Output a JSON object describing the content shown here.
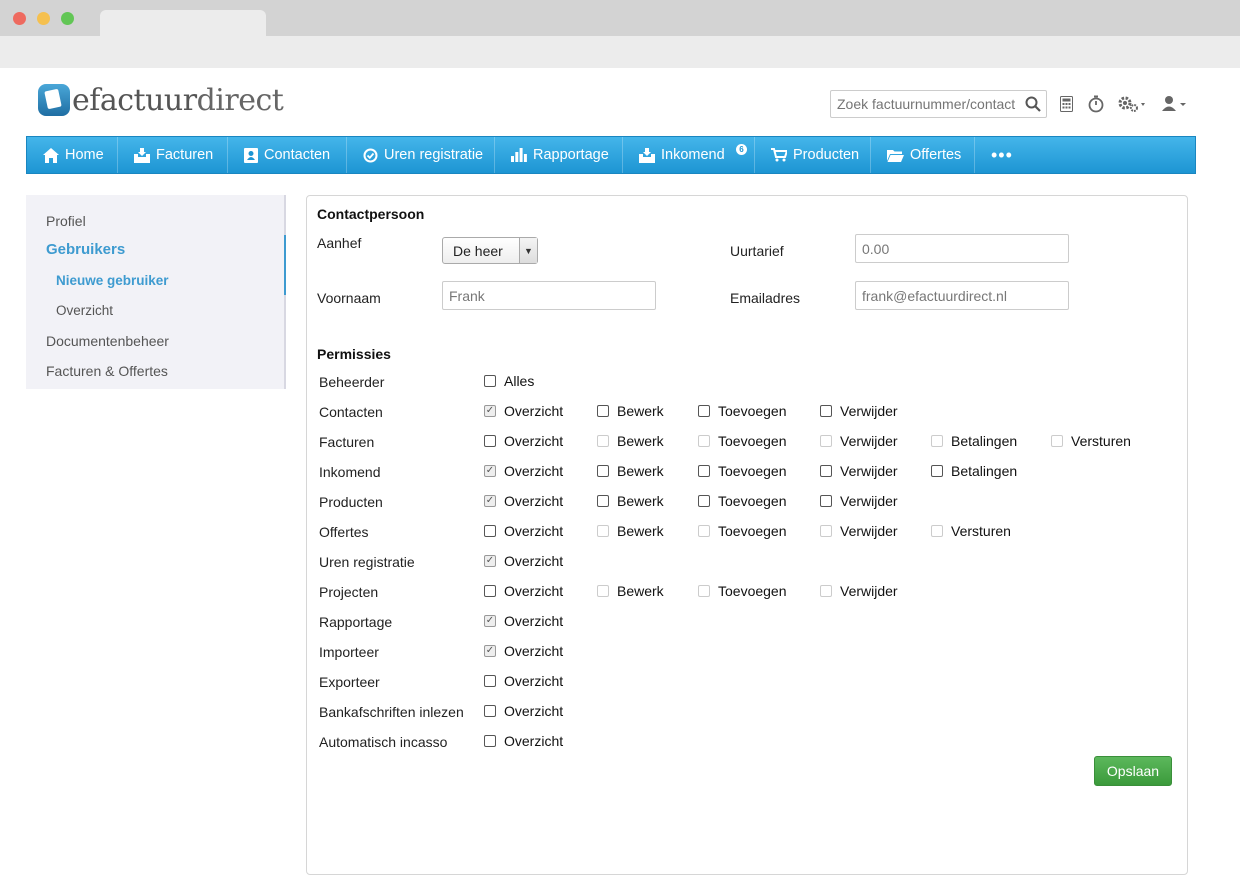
{
  "header": {
    "logo_part1": "efactuur",
    "logo_part2": "direct",
    "search_placeholder": "Zoek factuurnummer/contact"
  },
  "nav": {
    "items": [
      {
        "label": "Home",
        "icon": "home-icon"
      },
      {
        "label": "Facturen",
        "icon": "inbox-icon"
      },
      {
        "label": "Contacten",
        "icon": "contact-card-icon"
      },
      {
        "label": "Uren registratie",
        "icon": "clock-icon"
      },
      {
        "label": "Rapportage",
        "icon": "bar-chart-icon"
      },
      {
        "label": "Inkomend",
        "icon": "inbox-icon",
        "badge": "6"
      },
      {
        "label": "Producten",
        "icon": "cart-icon"
      },
      {
        "label": "Offertes",
        "icon": "folder-icon"
      }
    ],
    "more": "•••"
  },
  "sidebar": {
    "items": [
      {
        "label": "Profiel"
      },
      {
        "label": "Gebruikers"
      },
      {
        "label": "Nieuwe gebruiker"
      },
      {
        "label": "Overzicht"
      },
      {
        "label": "Documentenbeheer"
      },
      {
        "label": "Facturen & Offertes"
      }
    ]
  },
  "form": {
    "section_contact": "Contactpersoon",
    "aanhef_label": "Aanhef",
    "aanhef_value": "De heer",
    "uurtarief_label": "Uurtarief",
    "uurtarief_placeholder": "0.00",
    "voornaam_label": "Voornaam",
    "voornaam_placeholder": "Frank",
    "email_label": "Emailadres",
    "email_placeholder": "frank@efactuurdirect.nl",
    "section_permissions": "Permissies",
    "save_label": "Opslaan"
  },
  "permissions": [
    {
      "name": "Beheerder",
      "options": [
        {
          "label": "Alles",
          "state": "unchecked"
        }
      ]
    },
    {
      "name": "Contacten",
      "options": [
        {
          "label": "Overzicht",
          "state": "checked"
        },
        {
          "label": "Bewerk",
          "state": "unchecked"
        },
        {
          "label": "Toevoegen",
          "state": "unchecked"
        },
        {
          "label": "Verwijder",
          "state": "unchecked"
        }
      ]
    },
    {
      "name": "Facturen",
      "options": [
        {
          "label": "Overzicht",
          "state": "unchecked"
        },
        {
          "label": "Bewerk",
          "state": "dim"
        },
        {
          "label": "Toevoegen",
          "state": "dim"
        },
        {
          "label": "Verwijder",
          "state": "dim"
        },
        {
          "label": "Betalingen",
          "state": "dim"
        },
        {
          "label": "Versturen",
          "state": "dim"
        }
      ]
    },
    {
      "name": "Inkomend",
      "options": [
        {
          "label": "Overzicht",
          "state": "checked"
        },
        {
          "label": "Bewerk",
          "state": "unchecked"
        },
        {
          "label": "Toevoegen",
          "state": "unchecked"
        },
        {
          "label": "Verwijder",
          "state": "unchecked"
        },
        {
          "label": "Betalingen",
          "state": "unchecked"
        }
      ]
    },
    {
      "name": "Producten",
      "options": [
        {
          "label": "Overzicht",
          "state": "checked"
        },
        {
          "label": "Bewerk",
          "state": "unchecked"
        },
        {
          "label": "Toevoegen",
          "state": "unchecked"
        },
        {
          "label": "Verwijder",
          "state": "unchecked"
        }
      ]
    },
    {
      "name": "Offertes",
      "options": [
        {
          "label": "Overzicht",
          "state": "unchecked"
        },
        {
          "label": "Bewerk",
          "state": "dim"
        },
        {
          "label": "Toevoegen",
          "state": "dim"
        },
        {
          "label": "Verwijder",
          "state": "dim"
        },
        {
          "label": "Versturen",
          "state": "dim"
        }
      ]
    },
    {
      "name": "Uren registratie",
      "options": [
        {
          "label": "Overzicht",
          "state": "checked"
        }
      ]
    },
    {
      "name": "Projecten",
      "options": [
        {
          "label": "Overzicht",
          "state": "unchecked"
        },
        {
          "label": "Bewerk",
          "state": "dim"
        },
        {
          "label": "Toevoegen",
          "state": "dim"
        },
        {
          "label": "Verwijder",
          "state": "dim"
        }
      ]
    },
    {
      "name": "Rapportage",
      "options": [
        {
          "label": "Overzicht",
          "state": "checked"
        }
      ]
    },
    {
      "name": "Importeer",
      "options": [
        {
          "label": "Overzicht",
          "state": "checked"
        }
      ]
    },
    {
      "name": "Exporteer",
      "options": [
        {
          "label": "Overzicht",
          "state": "unchecked"
        }
      ]
    },
    {
      "name": "Bankafschriften inlezen",
      "options": [
        {
          "label": "Overzicht",
          "state": "unchecked"
        }
      ]
    },
    {
      "name": "Automatisch incasso",
      "options": [
        {
          "label": "Overzicht",
          "state": "unchecked"
        }
      ]
    }
  ],
  "colors": {
    "nav": "#1d95d3",
    "active": "#3e9bd0",
    "save": "#4cae4c"
  }
}
